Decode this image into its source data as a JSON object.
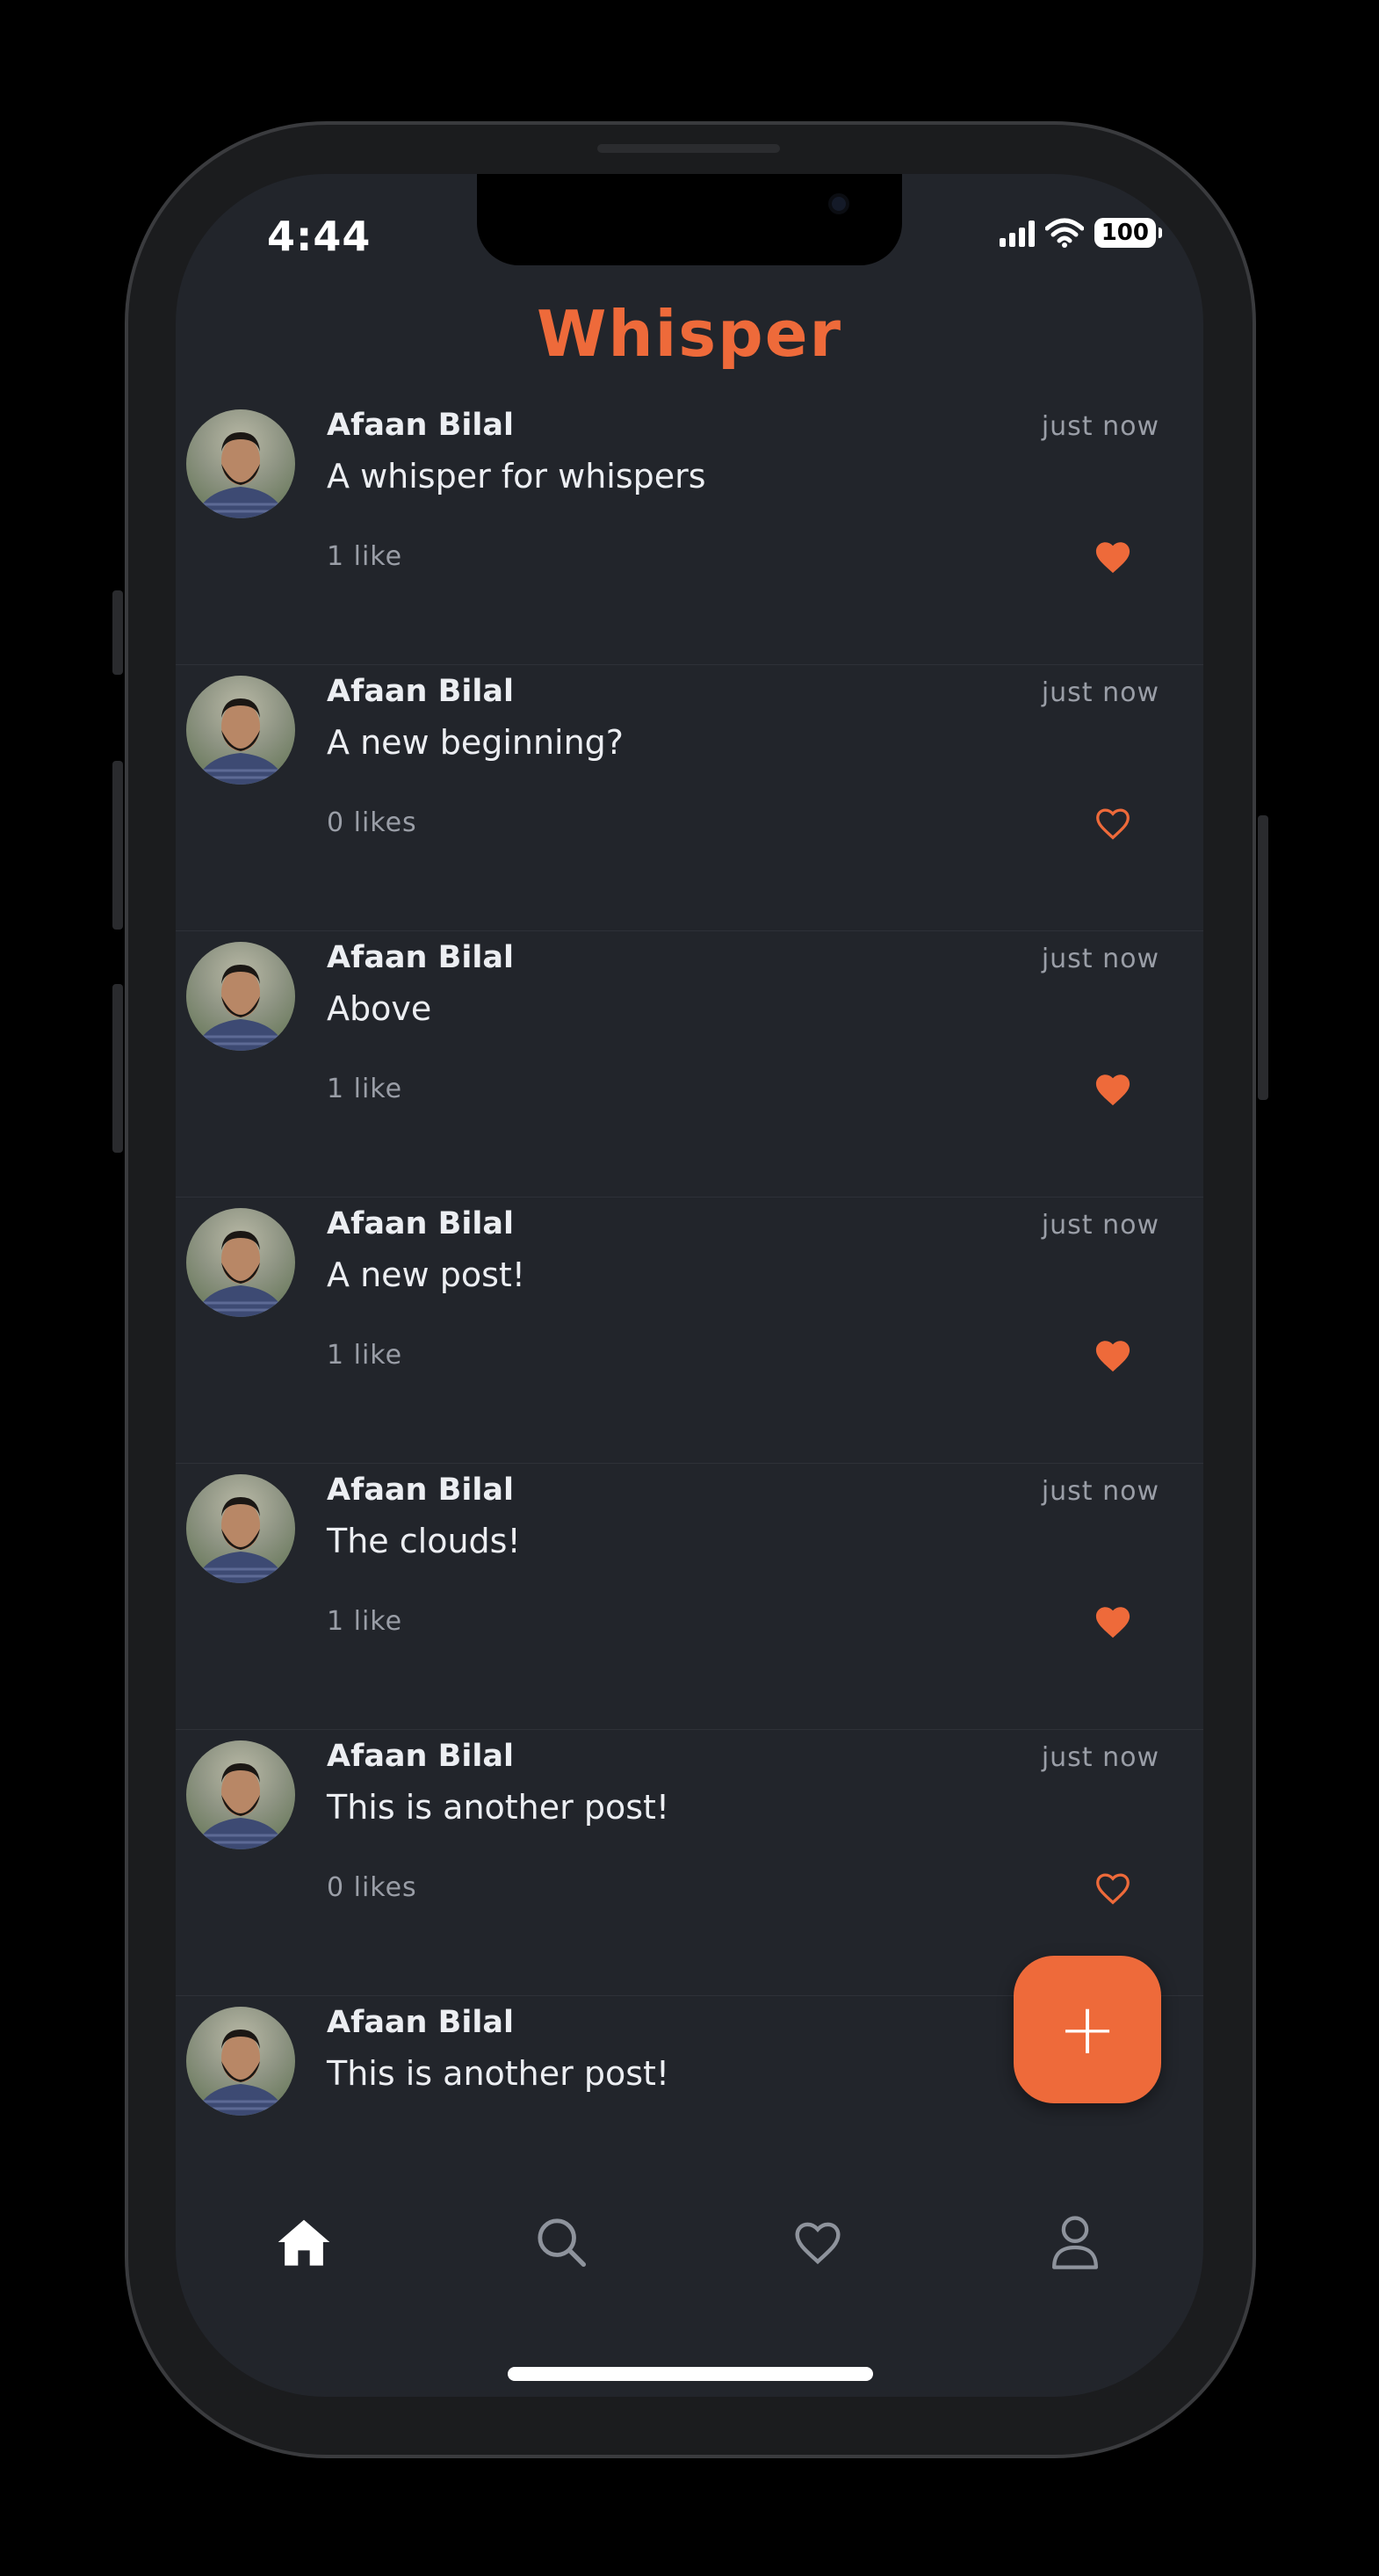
{
  "status_bar": {
    "time": "4:44",
    "battery": "100"
  },
  "app": {
    "title": "Whisper",
    "accent_color": "#ee6a3a"
  },
  "posts": [
    {
      "author": "Afaan Bilal",
      "time": "just now",
      "text": "A whisper for whispers",
      "likes": "1 like",
      "liked": true
    },
    {
      "author": "Afaan Bilal",
      "time": "just now",
      "text": "A new beginning?",
      "likes": "0 likes",
      "liked": false
    },
    {
      "author": "Afaan Bilal",
      "time": "just now",
      "text": "Above",
      "likes": "1 like",
      "liked": true
    },
    {
      "author": "Afaan Bilal",
      "time": "just now",
      "text": "A new post!",
      "likes": "1 like",
      "liked": true
    },
    {
      "author": "Afaan Bilal",
      "time": "just now",
      "text": "The clouds!",
      "likes": "1 like",
      "liked": true
    },
    {
      "author": "Afaan Bilal",
      "time": "just now",
      "text": "This is another post!",
      "likes": "0 likes",
      "liked": false
    },
    {
      "author": "Afaan Bilal",
      "time": "",
      "text": "This is another post!",
      "likes": "",
      "liked": null
    }
  ],
  "fab": {
    "icon": "plus-icon",
    "label": "+"
  },
  "tab_bar": [
    {
      "icon": "home-icon",
      "active": true
    },
    {
      "icon": "search-icon",
      "active": false
    },
    {
      "icon": "heart-icon",
      "active": false
    },
    {
      "icon": "profile-icon",
      "active": false
    }
  ]
}
